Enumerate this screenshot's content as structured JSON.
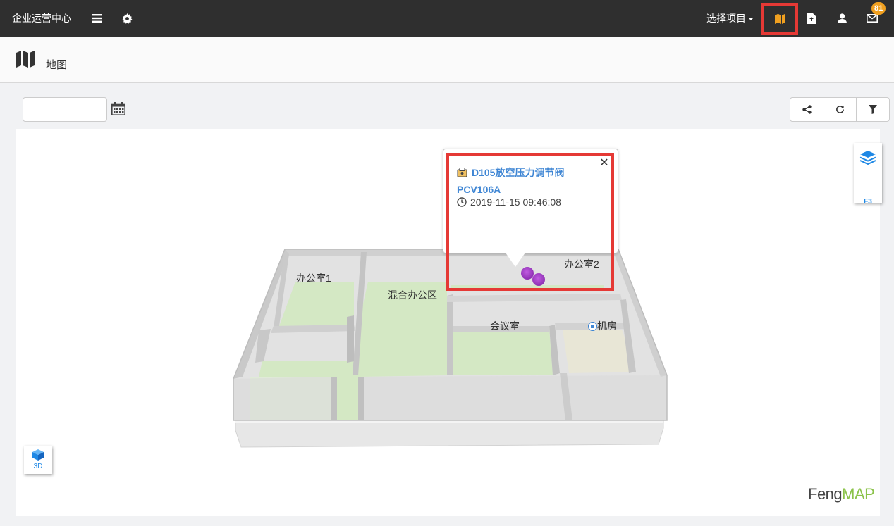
{
  "header": {
    "brand": "企业运营中心",
    "project_select": "选择项目",
    "message_count": "81"
  },
  "page": {
    "title": "地图"
  },
  "toolbar": {
    "date_value": "",
    "date_placeholder": ""
  },
  "map": {
    "floor": "F3",
    "view_mode": "3D",
    "logo_part1": "Feng",
    "logo_part2": "MAP",
    "rooms": {
      "office1": "办公室1",
      "mixed_office": "混合办公区",
      "office2": "办公室2",
      "meeting_room": "会议室",
      "machine_room": "机房"
    }
  },
  "popup": {
    "title": "D105放空压力调节阀PCV106A",
    "timestamp": "2019-11-15 09:46:08",
    "close": "✕"
  },
  "colors": {
    "topbar": "#2f2f2f",
    "accent_blue": "#3f86d4",
    "highlight_red": "#e53935",
    "map_icon_active": "#f0a020",
    "room_green": "#d4e8c4",
    "marker_purple": "#8e24aa"
  },
  "icons": {
    "menu": "hamburger-icon",
    "settings": "gear-icon",
    "map": "map-icon",
    "upload": "file-upload-icon",
    "user": "user-icon",
    "mail": "envelope-icon",
    "calendar": "calendar-icon",
    "share": "share-icon",
    "refresh": "refresh-icon",
    "filter": "filter-icon",
    "layers": "layers-icon",
    "cube": "cube-icon",
    "clock": "clock-icon",
    "device": "device-icon"
  }
}
